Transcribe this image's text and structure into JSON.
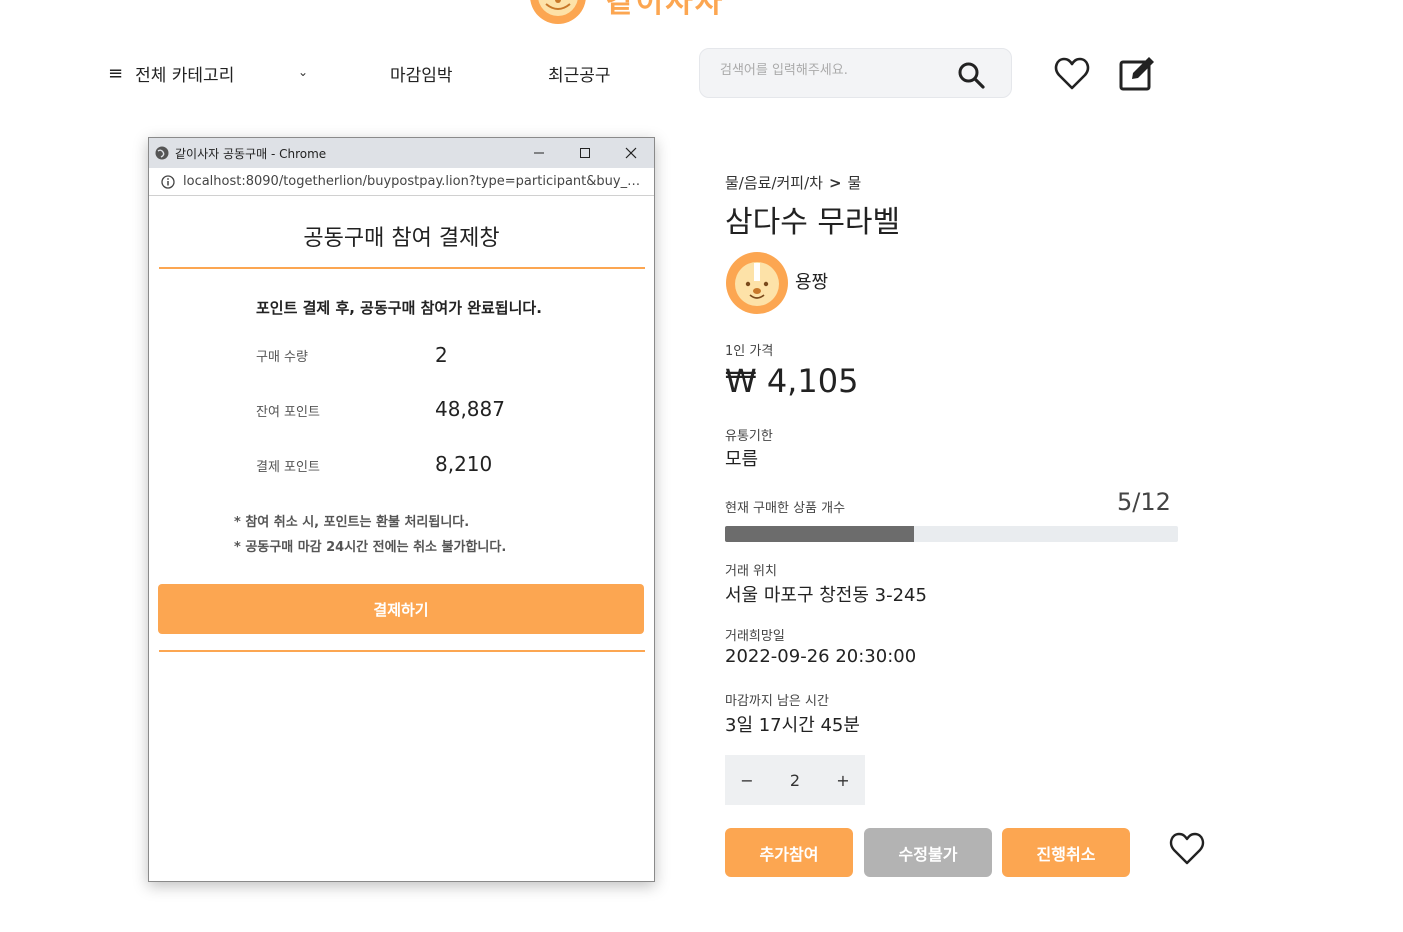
{
  "header": {
    "logo_text": "같이사자",
    "nav": {
      "category_label": "전체 카테고리",
      "deadline_label": "마감임박",
      "recent_label": "최근공구"
    },
    "search": {
      "placeholder": "검색어를 입력해주세요."
    },
    "icons": {
      "menu": "menu-icon",
      "chevron": "chevron-down-icon",
      "search": "search-icon",
      "wishlist": "heart-icon",
      "write": "edit-icon"
    }
  },
  "popup": {
    "window_title": "같이사자 공동구매 - Chrome",
    "url": "localhost:8090/togetherlion/buypostpay.lion?type=participant&buy_n...",
    "title": "공동구매 참여 결제창",
    "notice": "포인트 결제 후, 공동구매 참여가 완료됩니다.",
    "rows": [
      {
        "label": "구매 수량",
        "value": "2"
      },
      {
        "label": "잔여 포인트",
        "value": "48,887"
      },
      {
        "label": "결제 포인트",
        "value": "8,210"
      }
    ],
    "notes": [
      "* 참여 취소 시, 포인트는 환불 처리됩니다.",
      "* 공동구매 마감 24시간 전에는 취소 불가합니다."
    ],
    "pay_button": "결제하기"
  },
  "product": {
    "breadcrumb": {
      "category": "물/음료/커피/차",
      "separator": ">",
      "subcategory": "물"
    },
    "title": "삼다수 무라벨",
    "seller": "용짱",
    "price_label": "1인 가격",
    "price": "₩ 4,105",
    "expiry_label": "유통기한",
    "expiry": "모름",
    "count_label": "현재 구매한 상품 개수",
    "count": "5/12",
    "progress_fraction": 0.4167,
    "location_label": "거래 위치",
    "location": "서울 마포구 창전동 3-245",
    "date_label": "거래희망일",
    "date": "2022-09-26 20:30:00",
    "remaining_label": "마감까지 남은 시간",
    "remaining": "3일 17시간 45분",
    "quantity": "2",
    "buttons": {
      "join": "추가참여",
      "edit": "수정불가",
      "cancel": "진행취소"
    },
    "colors": {
      "accent": "#fca651",
      "disabled": "#b3b3b3"
    }
  }
}
